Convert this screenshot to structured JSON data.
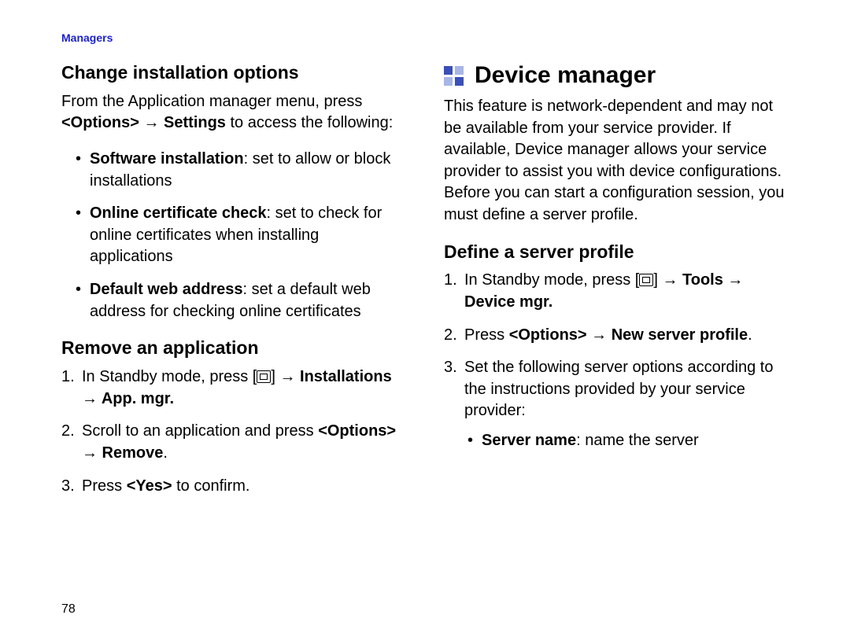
{
  "header": {
    "section": "Managers"
  },
  "page_number": "78",
  "left": {
    "h_change": "Change installation options",
    "intro_1": "From the Application manager menu, press ",
    "intro_b1": "<Options>",
    "intro_arrow": " → ",
    "intro_b2": "Settings",
    "intro_2": " to access the following:",
    "bullets": [
      {
        "b": "Software installation",
        "rest": ": set to allow or block installations"
      },
      {
        "b": "Online certificate check",
        "rest": ": set to check for online certificates when installing applications"
      },
      {
        "b": "Default web address",
        "rest": ": set a default web address for checking online certificates"
      }
    ],
    "h_remove": "Remove an application",
    "steps": {
      "s1_a": "In Standby mode, press [",
      "s1_b": "] → ",
      "s1_bold": "Installations → App. mgr.",
      "s2_a": "Scroll to an application and press ",
      "s2_bold": "<Options> → Remove",
      "s2_b": ".",
      "s3_a": "Press ",
      "s3_bold": "<Yes>",
      "s3_b": " to confirm."
    }
  },
  "right": {
    "h_device": "Device manager",
    "intro": "This feature is network-dependent and may not be available from your service provider. If available, Device manager allows your service provider to assist you with device configurations. Before you can start a configuration session, you must define a server profile.",
    "h_define": "Define a server profile",
    "steps": {
      "s1_a": "In Standby mode, press [",
      "s1_b": "] → ",
      "s1_bold": "Tools → Device mgr.",
      "s2_a": "Press ",
      "s2_bold": "<Options> → New server profile",
      "s2_b": ".",
      "s3": "Set the following server options according to the instructions provided by your service provider:",
      "s3_bullet_b": "Server name",
      "s3_bullet_rest": ": name the server"
    }
  }
}
